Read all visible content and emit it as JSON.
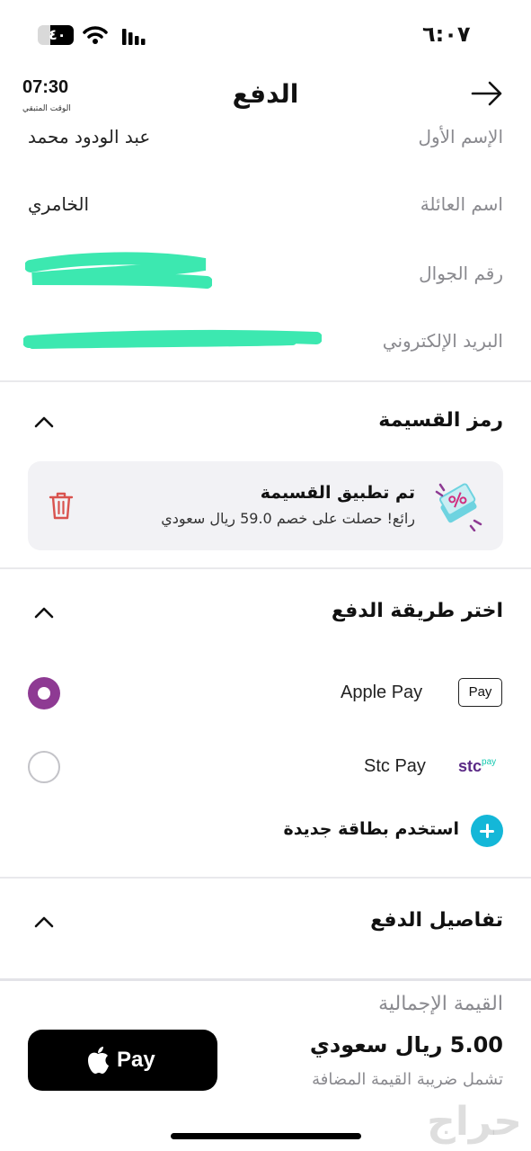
{
  "status_bar": {
    "time": "٦:٠٧",
    "battery": "٤٠"
  },
  "header": {
    "title": "الدفع",
    "timer_value": "07:30",
    "timer_label": "الوقت المتبقي"
  },
  "form": {
    "first_name_label": "الإسم الأول",
    "first_name_value": "عبد الودود محمد",
    "last_name_label": "اسم العائلة",
    "last_name_value": "الخامري",
    "phone_label": "رقم الجوال",
    "email_label": "البريد الإلكتروني"
  },
  "coupon": {
    "section_title": "رمز القسيمة",
    "applied_title": "تم تطبيق القسيمة",
    "applied_message": "رائع! حصلت على خصم 59.0 ريال سعودي"
  },
  "payment_method": {
    "section_title": "اختر طريقة الدفع",
    "options": [
      {
        "name": "Apple Pay",
        "badge": "Pay",
        "selected": true
      },
      {
        "name": "Stc Pay",
        "badge_main": "stc",
        "badge_sub": "pay",
        "selected": false
      }
    ],
    "add_card_label": "استخدم بطاقة جديدة"
  },
  "payment_details": {
    "section_title": "تفاصيل الدفع"
  },
  "footer": {
    "total_label": "القيمة الإجمالية",
    "total_amount": "5.00 ريال سعودي",
    "vat_note": "تشمل ضريبة القيمة المضافة",
    "pay_button_label": "Pay"
  },
  "watermark": "حراج",
  "colors": {
    "accent_purple": "#8e3a93",
    "accent_teal": "#14b7d8",
    "redaction_green": "#3ce8b0",
    "trash_red": "#d9534f"
  }
}
